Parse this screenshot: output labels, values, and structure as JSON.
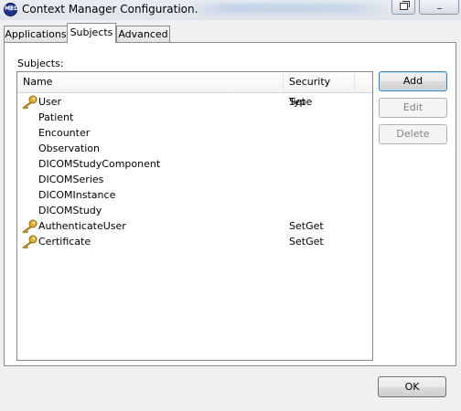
{
  "window": {
    "title": "Context Manager Configuration.",
    "icon_label": "MED"
  },
  "tabs": [
    {
      "label": "Applications",
      "selected": false
    },
    {
      "label": "Subjects",
      "selected": true
    },
    {
      "label": "Advanced",
      "selected": false
    }
  ],
  "subjects_panel": {
    "label": "Subjects:",
    "columns": [
      "Name",
      "Security Type"
    ],
    "rows": [
      {
        "name": "User",
        "security_type": "Set",
        "icon": "key-icon"
      },
      {
        "name": "Patient",
        "security_type": "",
        "icon": ""
      },
      {
        "name": "Encounter",
        "security_type": "",
        "icon": ""
      },
      {
        "name": "Observation",
        "security_type": "",
        "icon": ""
      },
      {
        "name": "DICOMStudyComponent",
        "security_type": "",
        "icon": ""
      },
      {
        "name": "DICOMSeries",
        "security_type": "",
        "icon": ""
      },
      {
        "name": "DICOMInstance",
        "security_type": "",
        "icon": ""
      },
      {
        "name": "DICOMStudy",
        "security_type": "",
        "icon": ""
      },
      {
        "name": "AuthenticateUser",
        "security_type": "SetGet",
        "icon": "key-icon"
      },
      {
        "name": "Certificate",
        "security_type": "SetGet",
        "icon": "key-icon"
      }
    ]
  },
  "buttons": {
    "add": "Add",
    "edit": "Edit",
    "delete": "Delete",
    "ok": "OK"
  },
  "colors": {
    "key_gold": "#e0b030",
    "key_outline": "#8a6a10"
  }
}
